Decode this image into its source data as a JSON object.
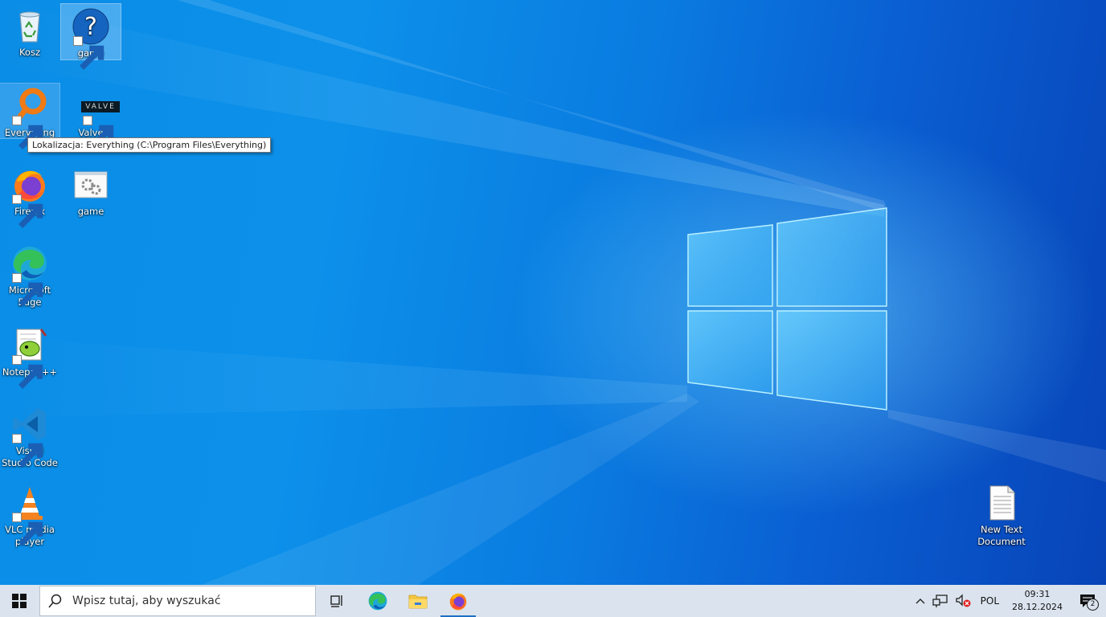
{
  "desktop": {
    "icons": {
      "recycle_bin": "Kosz",
      "game_help": "game",
      "everything": "Everything",
      "valve_games": "Valve Games",
      "valve_logo_text": "VALVE",
      "firefox": "Firefox",
      "game_settings": "game",
      "edge": "Microsoft Edge",
      "notepadpp": "Notepad++",
      "vscode": "Visual Studio Code",
      "vlc": "VLC media player",
      "new_text_doc": "New Text Document"
    },
    "tooltip": "Lokalizacja: Everything (C:\\Program Files\\Everything)"
  },
  "taskbar": {
    "search_placeholder": "Wpisz tutaj, aby wyszukać",
    "language": "POL",
    "time": "09:31",
    "date": "28.12.2024",
    "notification_count": "2"
  },
  "colors": {
    "accent": "#1e6fc4",
    "taskbar_bg": "#dbe4ee",
    "desktop_blue": "#0a8de6"
  }
}
